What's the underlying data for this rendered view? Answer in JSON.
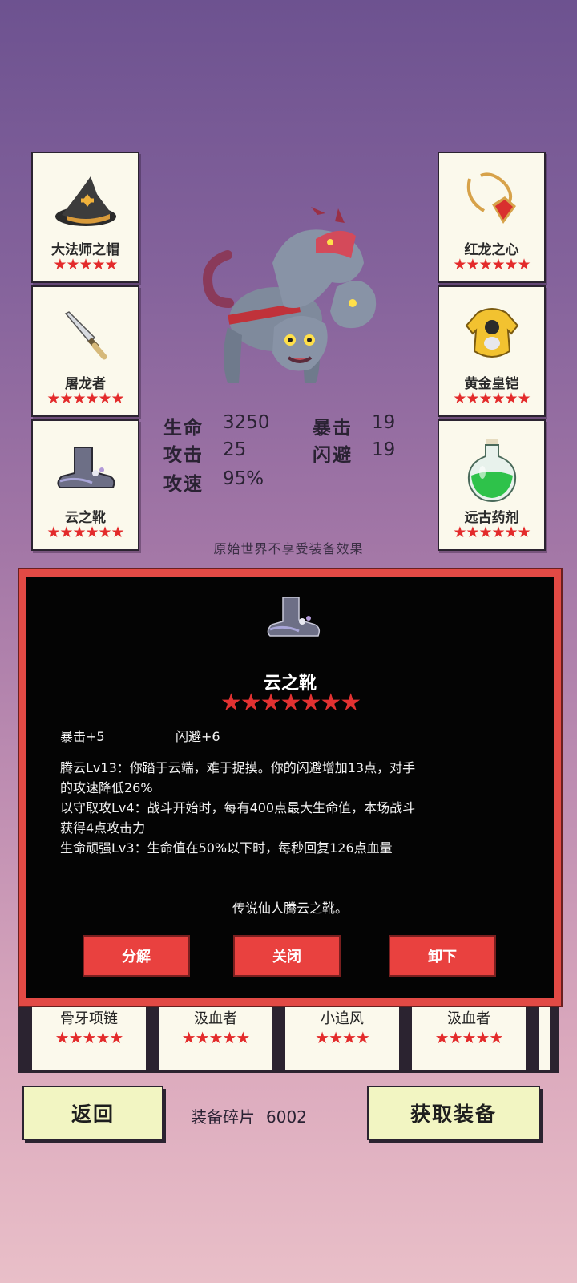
{
  "equipment": {
    "left": [
      {
        "name": "大法师之帽",
        "stars": "★★★★★",
        "icon": "wizard-hat-icon"
      },
      {
        "name": "屠龙者",
        "stars": "★★★★★★",
        "icon": "dagger-icon"
      },
      {
        "name": "云之靴",
        "stars": "★★★★★★",
        "icon": "cloud-boots-icon"
      }
    ],
    "right": [
      {
        "name": "红龙之心",
        "stars": "★★★★★★",
        "icon": "amulet-icon"
      },
      {
        "name": "黄金皇铠",
        "stars": "★★★★★★",
        "icon": "golden-armor-icon"
      },
      {
        "name": "远古药剂",
        "stars": "★★★★★★",
        "icon": "potion-icon"
      }
    ]
  },
  "stats": {
    "hp": {
      "label": "生命",
      "value": "3250"
    },
    "crit": {
      "label": "暴击",
      "value": "19"
    },
    "atk": {
      "label": "攻击",
      "value": "25"
    },
    "dodge": {
      "label": "闪避",
      "value": "19"
    },
    "aspd": {
      "label": "攻速",
      "value": "95%"
    }
  },
  "notice": "原始世界不享受装备效果",
  "dialog": {
    "title": "云之靴",
    "stars": "★★★★★★★",
    "attr1": "暴击+5",
    "attr2": "闪避+6",
    "desc": [
      "腾云Lv13：你踏于云端，难于捉摸。你的闪避增加13点，对手",
      "的攻速降低26%",
      "以守取攻Lv4：战斗开始时，每有400点最大生命值，本场战斗",
      "获得4点攻击力",
      "生命顽强Lv3：生命值在50%以下时，每秒回复126点血量"
    ],
    "lore": "传说仙人腾云之靴。",
    "buttons": {
      "decompose": "分解",
      "close": "关闭",
      "unequip": "卸下"
    }
  },
  "inventory": [
    {
      "name": "骨牙项链",
      "stars": "★★★★★"
    },
    {
      "name": "汲血者",
      "stars": "★★★★★"
    },
    {
      "name": "小追风",
      "stars": "★★★★"
    },
    {
      "name": "汲血者",
      "stars": "★★★★★"
    }
  ],
  "footer": {
    "back": "返回",
    "shards_label": "装备碎片",
    "shards_value": "6002",
    "get": "获取装备"
  },
  "colors": {
    "star": "#e32b2b",
    "dialog_border": "#e24a45",
    "button": "#f2f5c2"
  }
}
